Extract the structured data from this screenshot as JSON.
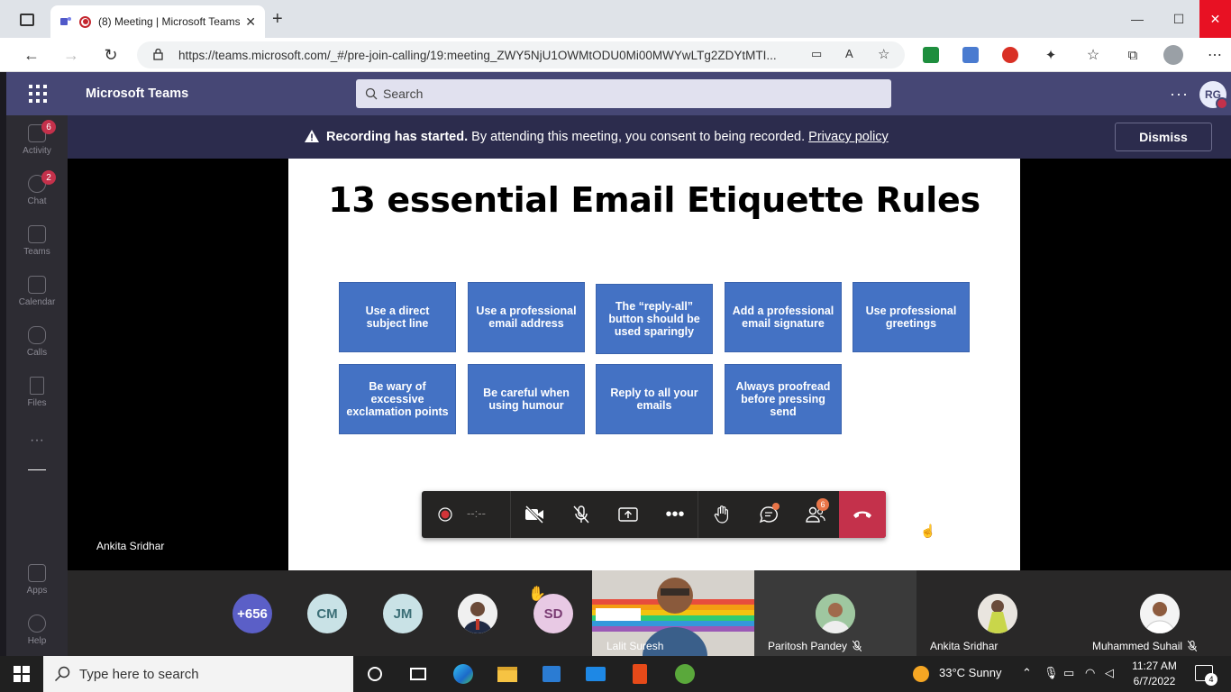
{
  "browser": {
    "tab_title": "(8) Meeting | Microsoft Teams",
    "url": "https://teams.microsoft.com/_#/pre-join-calling/19:meeting_ZWY5NjU1OWMtODU0Mi00MWYwLTg2ZDYtMTI..."
  },
  "teams": {
    "app_name": "Microsoft Teams",
    "search_placeholder": "Search",
    "user_initials": "RG",
    "rail": [
      {
        "label": "Activity",
        "badge": "6"
      },
      {
        "label": "Chat",
        "badge": "2"
      },
      {
        "label": "Teams",
        "badge": ""
      },
      {
        "label": "Calendar",
        "badge": ""
      },
      {
        "label": "Calls",
        "badge": ""
      },
      {
        "label": "Files",
        "badge": ""
      },
      {
        "label": "Apps",
        "badge": ""
      },
      {
        "label": "Help",
        "badge": ""
      }
    ]
  },
  "banner": {
    "title": "Recording has started.",
    "message": " By attending this meeting, you consent to being recorded. ",
    "link": "Privacy policy",
    "dismiss": "Dismiss"
  },
  "slide": {
    "title": "13 essential Email Etiquette Rules",
    "rules": [
      "Use a direct subject line",
      "Use a professional email address",
      "The “reply-all” button should be used sparingly",
      "Add a professional email signature",
      "Use professional greetings",
      "Be wary of excessive exclamation points",
      "Be careful when using humour",
      "Reply to all your emails",
      "Always proofread before pressing send"
    ]
  },
  "presenter_name": "Ankita Sridhar",
  "controls": {
    "timer": "--:--",
    "participants_badge": "6"
  },
  "gallery": {
    "overflow_count": "+656",
    "avatars": [
      "CM",
      "JM",
      "SD"
    ],
    "tiles": [
      {
        "name": "Lalit Suresh"
      },
      {
        "name": "Paritosh Pandey"
      },
      {
        "name": "Ankita Sridhar"
      },
      {
        "name": "Muhammed Suhail"
      }
    ]
  },
  "taskbar": {
    "search_placeholder": "Type here to search",
    "weather": "33°C  Sunny",
    "time": "11:27 AM",
    "date": "6/7/2022",
    "notifications": "4"
  },
  "colors": {
    "teams_purple": "#464775",
    "slide_box": "#4472c4",
    "hangup": "#c4314b"
  }
}
